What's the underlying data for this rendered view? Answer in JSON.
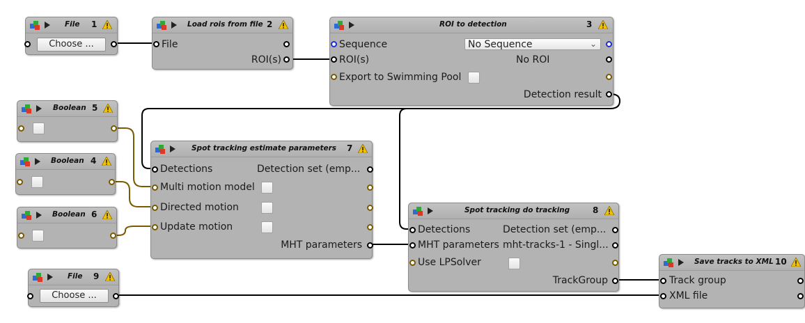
{
  "blocks": {
    "b1": {
      "title": "File",
      "num": "1",
      "button": "Choose ..."
    },
    "b2": {
      "title": "Load rois from file",
      "num": "2",
      "in_file": "File",
      "out_rois": "ROI(s)"
    },
    "b3": {
      "title": "ROI to detection",
      "num": "3",
      "sequence_label": "Sequence",
      "sequence_value": "No Sequence",
      "rois_label": "ROI(s)",
      "rois_value": "No ROI",
      "export_label": "Export to Swimming Pool",
      "result_label": "Detection result"
    },
    "b5": {
      "title": "Boolean",
      "num": "5"
    },
    "b4": {
      "title": "Boolean",
      "num": "4"
    },
    "b6": {
      "title": "Boolean",
      "num": "6"
    },
    "b7": {
      "title": "Spot tracking estimate parameters",
      "num": "7",
      "detections": "Detections",
      "detections_value": "Detection set (emp...",
      "multi": "Multi motion model",
      "directed": "Directed motion",
      "update": "Update motion",
      "mht": "MHT parameters"
    },
    "b8": {
      "title": "Spot tracking do tracking",
      "num": "8",
      "detections": "Detections",
      "detections_value": "Detection set (emp...",
      "mht": "MHT parameters",
      "mht_value": "mht-tracks-1 - Singl...",
      "lp": "Use LPSolver",
      "trackgroup": "TrackGroup"
    },
    "b9": {
      "title": "File",
      "num": "9",
      "button": "Choose ..."
    },
    "b10": {
      "title": "Save tracks to XML",
      "num": "10",
      "track_group": "Track group",
      "xml_file": "XML file"
    }
  },
  "colors": {
    "block_bg": "#b3b3b3",
    "wire": "#000000",
    "wire_bool": "#7a5a00",
    "port_blue": "#1a2fd8"
  },
  "icons": [
    "protocol-logo-icon",
    "run-icon",
    "warning-icon",
    "chevron-down-icon"
  ]
}
